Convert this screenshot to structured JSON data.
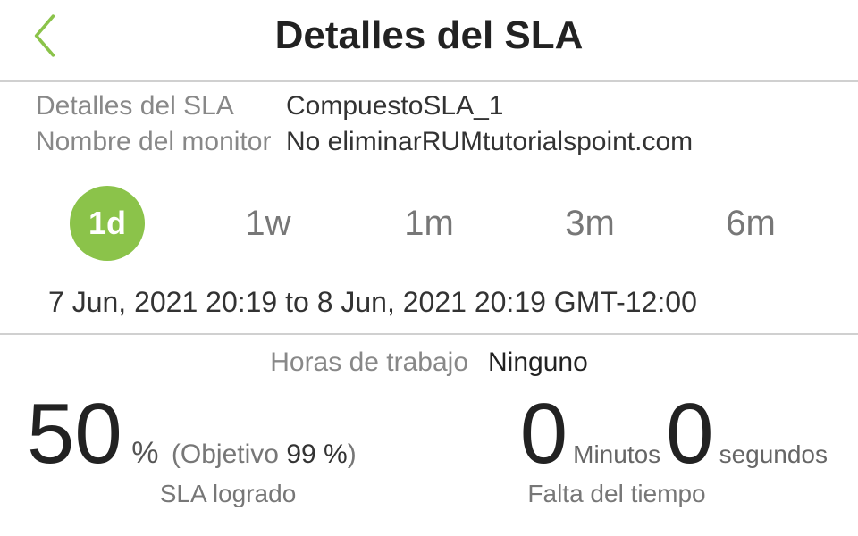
{
  "header": {
    "title": "Detalles del SLA"
  },
  "details": {
    "sla_label": "Detalles del SLA",
    "sla_value": "CompuestoSLA_1",
    "monitor_label": "Nombre del monitor",
    "monitor_value": "No eliminarRUMtutorialspoint.com"
  },
  "tabs": {
    "t1d": "1d",
    "t1w": "1w",
    "t1m": "1m",
    "t3m": "3m",
    "t6m": "6m"
  },
  "date_range": "7 Jun, 2021 20:19 to 8 Jun, 2021 20:19 GMT-12:00",
  "working_hours": {
    "label": "Horas de trabajo",
    "value": "Ninguno"
  },
  "metrics": {
    "achieved_value": "50",
    "achieved_pct": "%",
    "target_prefix": "(Objetivo ",
    "target_value": "99 %",
    "target_suffix": ")",
    "achieved_caption": "SLA logrado",
    "minutes_value": "0",
    "minutes_unit": "Minutos",
    "seconds_value": "0",
    "seconds_unit": "segundos",
    "missing_caption": "Falta del tiempo"
  }
}
